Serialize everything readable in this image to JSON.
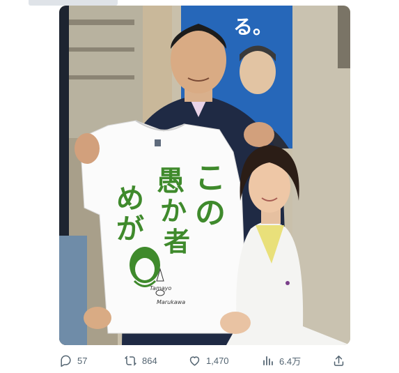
{
  "tweet": {
    "photo": {
      "shirt_text": [
        "こ",
        "の",
        "愚",
        "か",
        "者",
        "め",
        "が"
      ],
      "shirt_signature": [
        "Tamayo",
        "Marukawa"
      ]
    },
    "actions": {
      "replies": "57",
      "reposts": "864",
      "likes": "1,470",
      "views": "6.4万"
    },
    "icons": {
      "reply": "reply-icon",
      "repost": "repost-icon",
      "like": "like-icon",
      "views": "views-icon",
      "share": "share-icon"
    },
    "colors": {
      "icon_gray": "#536471",
      "shirt_ink": "#3f8a2c",
      "poster_blue": "#1f5fb0"
    }
  }
}
